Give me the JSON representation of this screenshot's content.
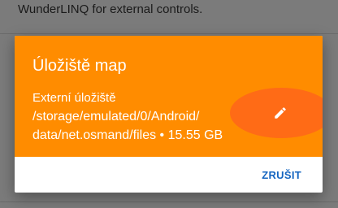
{
  "background": {
    "text_line": "WunderLINQ for external controls."
  },
  "dialog": {
    "title": "Úložiště map",
    "storage_label": "Externí úložiště",
    "storage_path_line1": "/storage/emulated/0/Android/",
    "storage_path_line2": "data/net.osmand/files • 15.55 GB",
    "edit_icon": "pencil-icon",
    "cancel_label": "ZRUŠIT"
  },
  "colors": {
    "accent": "#ff8c00",
    "button_text": "#1565c0",
    "scrim": "#7b7b7b"
  }
}
